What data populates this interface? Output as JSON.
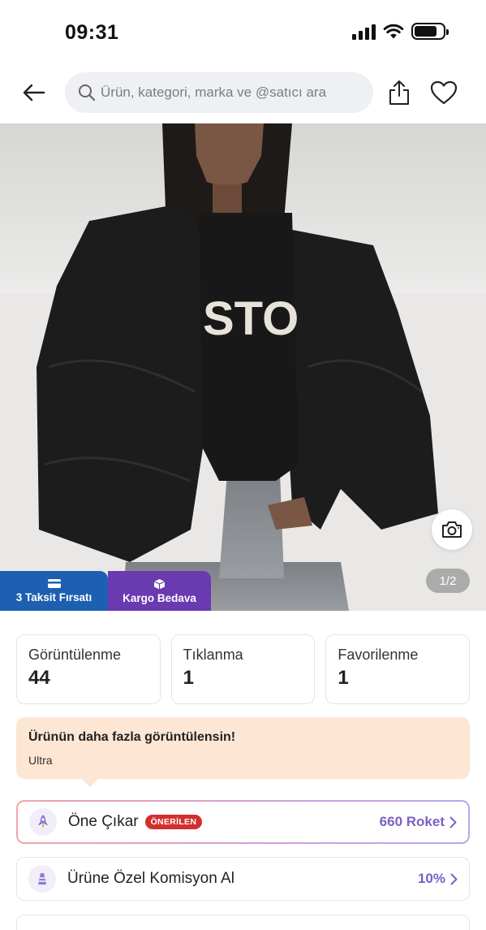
{
  "status_bar": {
    "time": "09:31"
  },
  "search": {
    "placeholder": "Ürün, kategori, marka ve @satıcı ara"
  },
  "product": {
    "image_alt": "Black puffer jacket",
    "pager": "1/2",
    "badges": [
      {
        "label": "3 Taksit Fırsatı",
        "color": "#1d5fb0",
        "icon": "card-icon"
      },
      {
        "label": "Kargo Bedava",
        "color": "#6a3ab1",
        "icon": "box-icon"
      }
    ]
  },
  "stats": [
    {
      "label": "Görüntülenme",
      "value": "44"
    },
    {
      "label": "Tıklanma",
      "value": "1"
    },
    {
      "label": "Favorilenme",
      "value": "1"
    }
  ],
  "promo": {
    "title": "Ürünün daha fazla görüntülensin!",
    "subtitle": "Ultra"
  },
  "options": [
    {
      "label": "Öne Çıkar",
      "badge": "ÖNERİLEN",
      "value": "660 Roket",
      "icon": "rocket-icon"
    },
    {
      "label": "Ürüne Özel Komisyon Al",
      "value": "10%",
      "icon": "gift-icon"
    }
  ],
  "colors": {
    "accent": "#7b5fc4",
    "badge_red": "#d32f2f",
    "promo_bg": "#fde6d4"
  }
}
